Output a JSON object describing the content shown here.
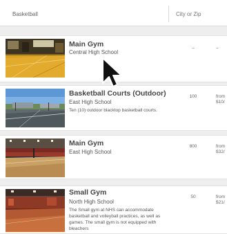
{
  "search": {
    "query": "Basketball",
    "location_placeholder": "City or Zip"
  },
  "results": [
    {
      "name": "Main Gym",
      "school": "Central High School",
      "description": "",
      "capacity": "–",
      "price": "–"
    },
    {
      "name": "Basketball Courts (Outdoor)",
      "school": "East High School",
      "description": "Ten (10) outdoor blacktop basketball courts.",
      "capacity": "100",
      "price_line1": "from",
      "price_line2": "$10/"
    },
    {
      "name": "Main Gym",
      "school": "East High School",
      "description": "",
      "capacity": "800",
      "price_line1": "from",
      "price_line2": "$32/"
    },
    {
      "name": "Small Gym",
      "school": "North High School",
      "description": "The Small gym at NHS can accommodate basketball and volleyball practices, as well as games. The small gym is not equipped with bleachers",
      "capacity": "50",
      "price_line1": "from",
      "price_line2": "$21/"
    }
  ],
  "colors": {
    "background": "#eeeeee",
    "card": "#ffffff",
    "gym_floor": "#d9a023"
  }
}
